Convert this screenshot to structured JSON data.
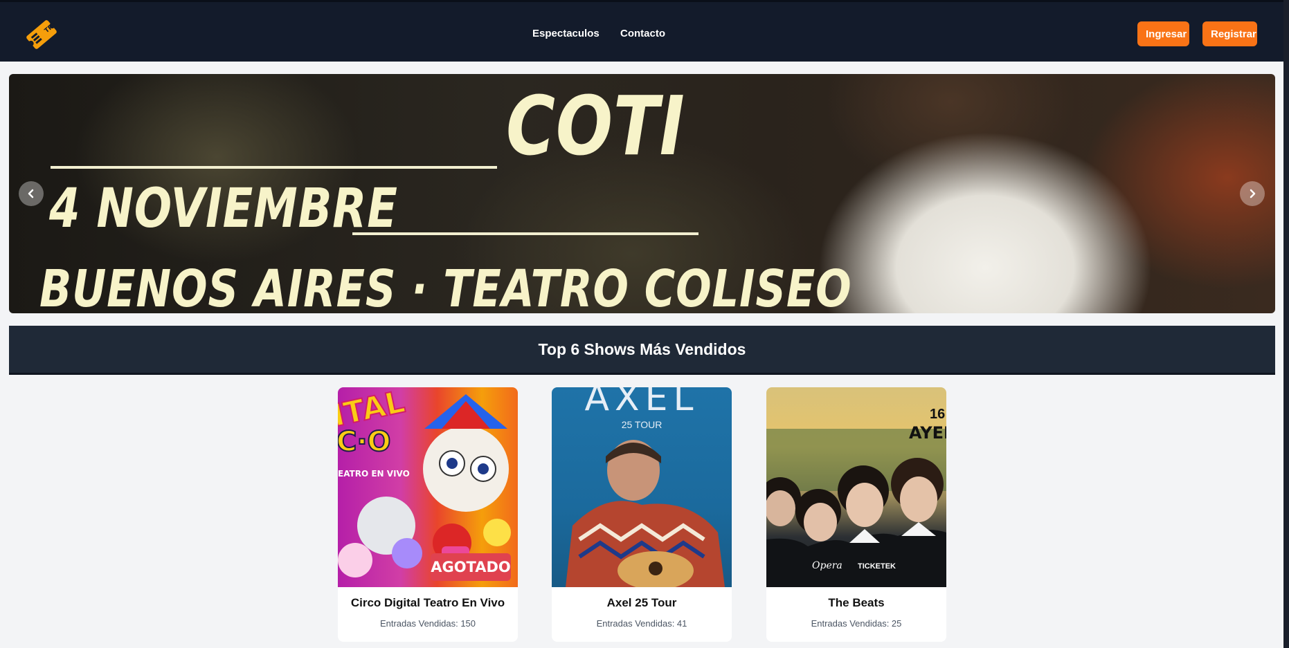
{
  "nav": {
    "links": [
      "Espectaculos",
      "Contacto"
    ],
    "login_label": "Ingresar",
    "register_label": "Registrar"
  },
  "logo": {
    "text": "TP"
  },
  "carousel": {
    "slide_headline": "COTI",
    "slide_date": "4 NOVIEMBRE",
    "slide_venue": "BUENOS AIRES · TEATRO COLISEO"
  },
  "section": {
    "title": "Top 6 Shows Más Vendidos"
  },
  "shows": [
    {
      "title": "Circo Digital Teatro En Vivo",
      "sold": "Entradas Vendidas: 150",
      "badge": "AGOTADO",
      "poster_text": "ITAL",
      "poster_text2": "C·O",
      "poster_sub": "EATRO EN VIVO"
    },
    {
      "title": "Axel 25 Tour",
      "sold": "Entradas Vendidas: 41",
      "poster_text": "AXEL",
      "poster_sub": "25 TOUR"
    },
    {
      "title": "The Beats",
      "sold": "Entradas Vendidas: 25",
      "poster_text": "16",
      "poster_text2": "AYER",
      "poster_brand1": "Opera",
      "poster_brand2": "TICKETEK"
    }
  ]
}
